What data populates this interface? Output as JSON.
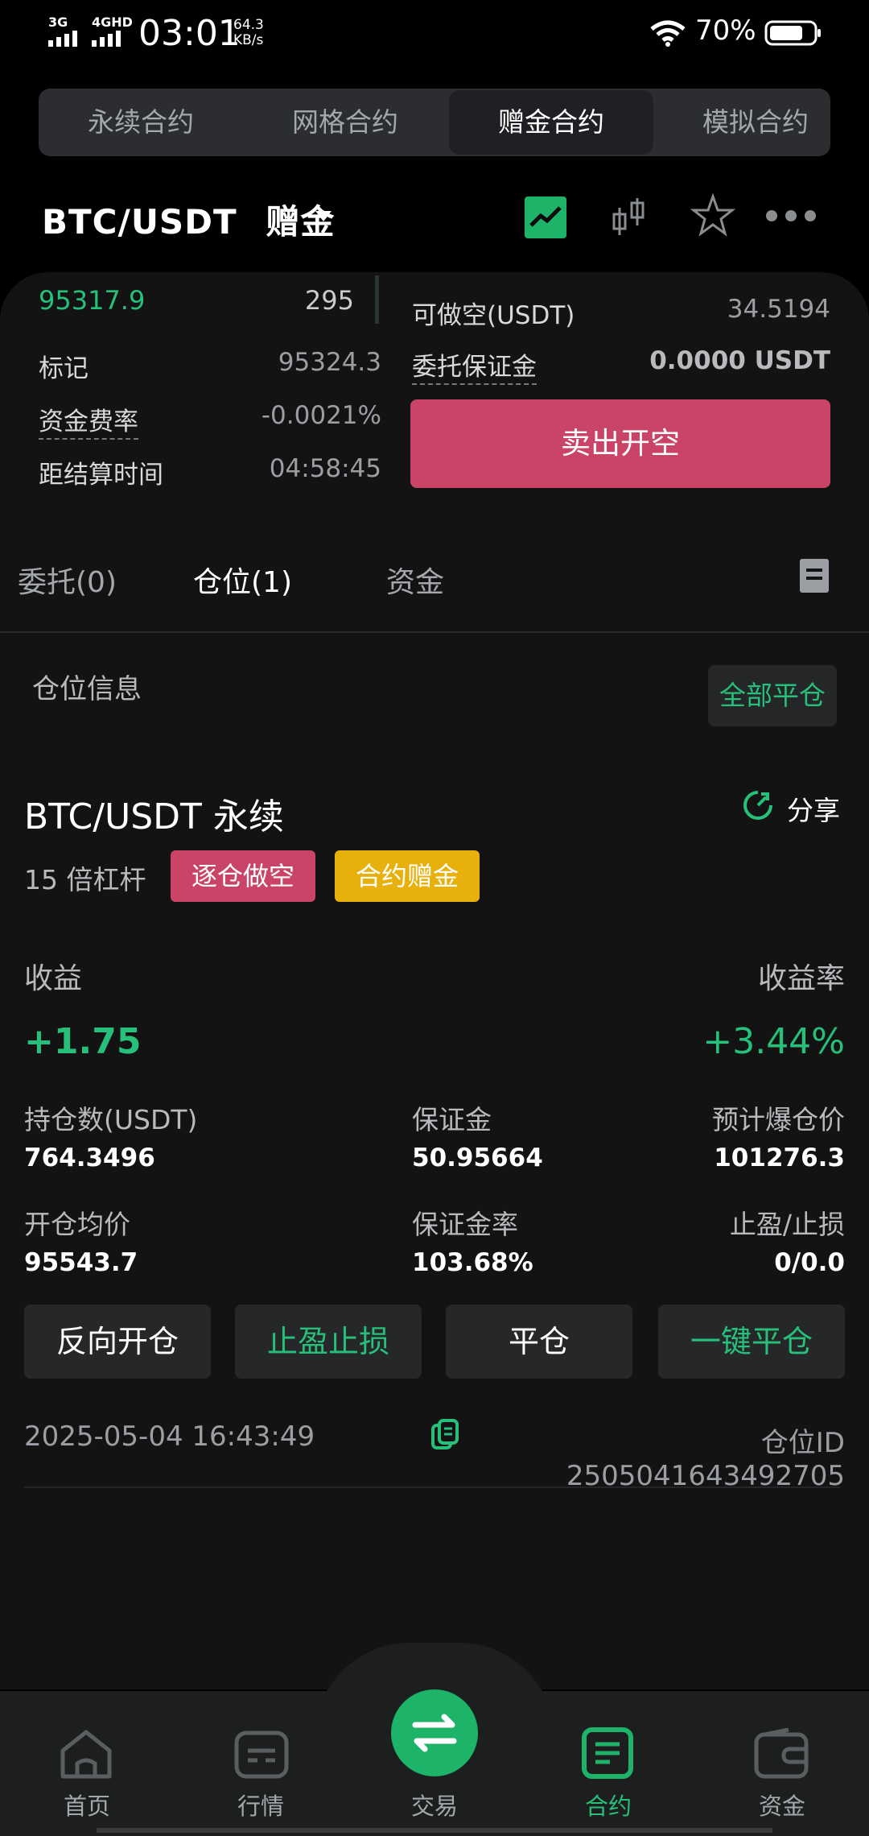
{
  "status_bar": {
    "signal1": "3G",
    "signal2": "4GHD",
    "time": "03:01",
    "speed_value": "64.3",
    "speed_unit": "KB/s",
    "battery": "70%"
  },
  "contract_tabs": [
    "永续合约",
    "网格合约",
    "赠金合约",
    "模拟合约"
  ],
  "active_contract_tab": "赠金合约",
  "pair": {
    "name": "BTC/USDT",
    "suffix": "赠金"
  },
  "market": {
    "last_price": "95317.9",
    "last_qty": "295",
    "mark_label": "标记",
    "mark_value": "95324.3",
    "funding_label": "资金费率",
    "funding_value": "-0.0021%",
    "settle_label": "距结算时间",
    "settle_value": "04:58:45"
  },
  "order": {
    "short_avail_label": "可做空(USDT)",
    "short_avail_value": "34.5194",
    "margin_label": "委托保证金",
    "margin_value": "0.0000 USDT",
    "sell_button": "卖出开空"
  },
  "sub_tabs": [
    "委托(0)",
    "仓位(1)",
    "资金"
  ],
  "active_sub_tab": "仓位(1)",
  "position_section": {
    "title": "仓位信息",
    "close_all": "全部平仓"
  },
  "position": {
    "symbol": "BTC/USDT 永续",
    "share": "分享",
    "leverage": "15 倍杠杆",
    "tag_mode": "逐仓做空",
    "tag_bonus": "合约赠金",
    "pnl_label": "收益",
    "pnl_value": "+1.75",
    "roe_label": "收益率",
    "roe_value": "+3.44%",
    "size_label": "持仓数(USDT)",
    "size_value": "764.3496",
    "margin_label": "保证金",
    "margin_value": "50.95664",
    "liq_label": "预计爆仓价",
    "liq_value": "101276.3",
    "entry_label": "开仓均价",
    "entry_value": "95543.7",
    "margin_ratio_label": "保证金率",
    "margin_ratio_value": "103.68%",
    "tpsl_label": "止盈/止损",
    "tpsl_value": "0/0.0",
    "buttons": [
      "反向开仓",
      "止盈止损",
      "平仓",
      "一键平仓"
    ],
    "time": "2025-05-04 16:43:49",
    "position_id": "仓位ID 2505041643492705"
  },
  "bottom_nav": [
    "首页",
    "行情",
    "交易",
    "合约",
    "资金"
  ],
  "active_nav": "合约",
  "colors": {
    "accent_green": "#27c07a",
    "sell_red": "#c94466",
    "bonus_yellow": "#e8b00a"
  }
}
